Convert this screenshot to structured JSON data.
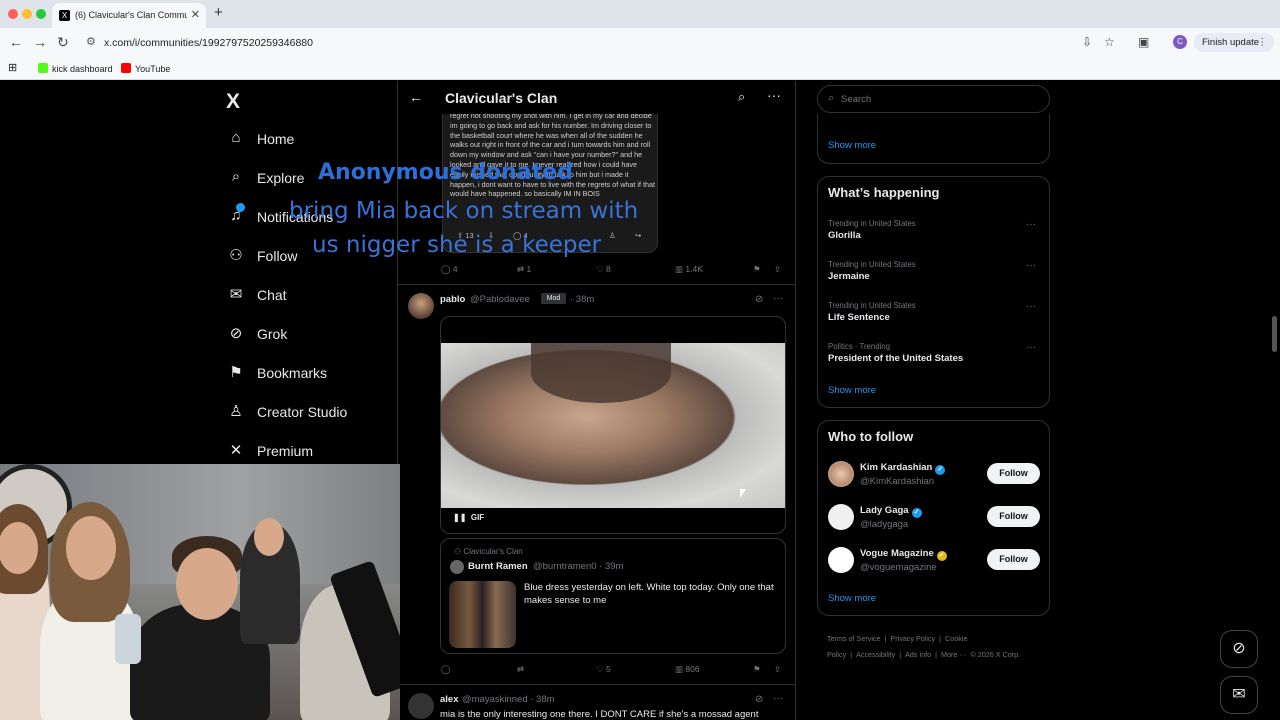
{
  "browser": {
    "tab_title": "(6) Clavicular's Clan Commu",
    "new_tab": "+",
    "url": "x.com/i/communities/1992797520259346880",
    "finish_update": "Finish update",
    "profile_initial": "C",
    "bookmarks": [
      {
        "label": "kick dashboard",
        "color": "#53fc18"
      },
      {
        "label": "YouTube",
        "color": "#ff0000"
      }
    ]
  },
  "sidebar": {
    "logo": "X",
    "items": [
      {
        "label": "Home",
        "icon": "home-icon",
        "glyph": "⌂"
      },
      {
        "label": "Explore",
        "icon": "search-icon",
        "glyph": "⌕"
      },
      {
        "label": "Notifications",
        "icon": "bell-icon",
        "glyph": "♫",
        "badge": "6"
      },
      {
        "label": "Follow",
        "icon": "person-plus-icon",
        "glyph": "⚇"
      },
      {
        "label": "Chat",
        "icon": "mail-icon",
        "glyph": "✉"
      },
      {
        "label": "Grok",
        "icon": "grok-icon",
        "glyph": "⊘"
      },
      {
        "label": "Bookmarks",
        "icon": "bookmark-icon",
        "glyph": "⚑"
      },
      {
        "label": "Creator Studio",
        "icon": "creator-studio-icon",
        "glyph": "♙"
      },
      {
        "label": "Premium",
        "icon": "x-premium-icon",
        "glyph": "✕"
      }
    ]
  },
  "header": {
    "title": "Clavicular's Clan"
  },
  "post1": {
    "quoted_text": "regret not shooting my shot with him. I get in my car and decide im going to go back and ask for his number. Im driving closer to the basketball court where he was when all of the sudden he walks out right in front of the car and i turn towards him and roll down my window and ask \"can i have your number?\" and he looked and gave it to me. I never realized how i could have easily missed that opportunity to talk to him but i made it happen, i dont want to have to live with the regrets of what if that would have happened. so basically IM IN BOIS",
    "quoted_votes": "13",
    "quoted_replies": "4",
    "replies": "4",
    "reposts": "1",
    "likes": "8",
    "views": "1.4K"
  },
  "post2": {
    "name": "pablo",
    "handle": "@Pablodavee",
    "badge": "Mod",
    "time": "· 38m",
    "gif_label": "GIF",
    "quote": {
      "community": "Clavicular's Clan",
      "name": "Burnt Ramen",
      "handle": "@burntramen0 · 39m",
      "text": "Blue dress yesterday on left. White top today. Only one that makes sense to me"
    },
    "replies": "",
    "reposts": "",
    "likes": "5",
    "views": "806"
  },
  "post3": {
    "name": "alex",
    "handle": "@mayaskinned · 38m",
    "text": "mia is the only interesting one there. I DONT CARE if she's a mossad agent"
  },
  "right": {
    "search_placeholder": "Search",
    "top_show_more": "Show more",
    "whats_happening": {
      "title": "What’s happening",
      "trends": [
        {
          "context": "Trending in United States",
          "name": "Glorilla"
        },
        {
          "context": "Trending in United States",
          "name": "Jermaine"
        },
        {
          "context": "Trending in United States",
          "name": "Life Sentence"
        },
        {
          "context": "Politics · Trending",
          "name": "President of the United States"
        }
      ],
      "show_more": "Show more"
    },
    "who_to_follow": {
      "title": "Who to follow",
      "accounts": [
        {
          "name": "Kim Kardashian",
          "handle": "@KimKardashian",
          "verified": "blue"
        },
        {
          "name": "Lady Gaga",
          "handle": "@ladygaga",
          "verified": "blue"
        },
        {
          "name": "Vogue Magazine",
          "handle": "@voguemagazine",
          "verified": "gold"
        }
      ],
      "follow_label": "Follow",
      "show_more": "Show more"
    },
    "footer": [
      "Terms of Service",
      "|",
      "Privacy Policy",
      "|",
      "Cookie Policy",
      "|",
      "Accessibility",
      "|",
      "Ads info",
      "|",
      "More ···",
      "© 2026 X Corp."
    ]
  },
  "overlay": {
    "title": "Anonymous donated",
    "message_line1": "bring Mia back on stream with",
    "message_line2": "us nigger she is a keeper"
  },
  "colors": {
    "accent": "#1d9bf0",
    "overlay_text": "#2e6ed9",
    "background": "#000000"
  }
}
